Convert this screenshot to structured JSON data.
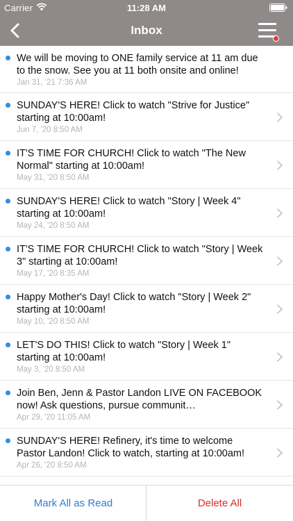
{
  "status_bar": {
    "carrier": "Carrier",
    "time": "11:28 AM"
  },
  "nav": {
    "title": "Inbox"
  },
  "messages": [
    {
      "text": "We will be moving to ONE family service at 11 am due to the snow. See you at 11 both onsite and online!",
      "date": "Jan 31, '21 7:36 AM",
      "unread": true
    },
    {
      "text": "SUNDAY'S HERE! Click to watch \"Strive for Justice\" starting at 10:00am!",
      "date": "Jun 7, '20 8:50 AM",
      "unread": true
    },
    {
      "text": "IT'S TIME FOR CHURCH! Click to watch \"The New Normal\" starting at 10:00am!",
      "date": "May 31, '20 8:50 AM",
      "unread": true
    },
    {
      "text": "SUNDAY'S HERE! Click to watch \"Story | Week 4\" starting at 10:00am!",
      "date": "May 24, '20 8:50 AM",
      "unread": true
    },
    {
      "text": "IT'S TIME FOR CHURCH! Click to watch \"Story | Week 3\" starting at 10:00am!",
      "date": "May 17, '20 8:35 AM",
      "unread": true
    },
    {
      "text": "Happy Mother's Day! Click to watch \"Story | Week 2\" starting at 10:00am!",
      "date": "May 10, '20 8:50 AM",
      "unread": true
    },
    {
      "text": "LET'S DO THIS! Click to watch \"Story | Week 1\" starting at 10:00am!",
      "date": "May 3, '20 8:50 AM",
      "unread": true
    },
    {
      "text": "Join Ben, Jenn & Pastor Landon LIVE ON FACEBOOK now! Ask questions, pursue communit…",
      "date": "Apr 29, '20 11:05 AM",
      "unread": true
    },
    {
      "text": "SUNDAY'S HERE! Refinery, it's time to welcome Pastor Landon! Click to watch, starting at 10:00am!",
      "date": "Apr 26, '20 8:50 AM",
      "unread": true
    }
  ],
  "toolbar": {
    "mark_all_label": "Mark All as Read",
    "delete_all_label": "Delete All"
  },
  "colors": {
    "nav_bg": "#8f8a89",
    "unread_dot": "#2f8fe0",
    "mark_all": "#2c7fd4",
    "delete_all": "#d62d2d",
    "menu_badge": "#e23c3c"
  },
  "icons": {
    "back": "chevron-left-icon",
    "menu": "hamburger-menu-icon",
    "row_disclosure": "chevron-right-icon"
  }
}
